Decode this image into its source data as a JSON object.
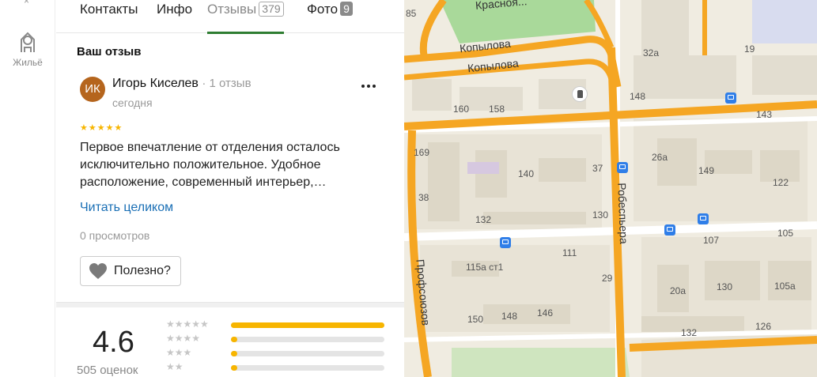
{
  "rail": {
    "top_glyph": "×",
    "housing_label": "Жильё"
  },
  "tabs": [
    {
      "label": "Контакты"
    },
    {
      "label": "Инфо"
    },
    {
      "label": "Отзывы",
      "count": "379"
    },
    {
      "label": "Фото",
      "count": "9"
    }
  ],
  "your_review": {
    "title": "Ваш отзыв",
    "avatar_initials": "ИК",
    "author": "Игорь Киселев",
    "author_reviews": "· 1 отзыв",
    "date": "сегодня",
    "stars": "★★★★★",
    "rating": 5,
    "text": "Первое впечатление от отделения осталось исключительно положительное. Удобное расположение, современный интерьер,…",
    "read_more": "Читать целиком",
    "views": "0 просмотров",
    "helpful": "Полезно?"
  },
  "summary": {
    "average": "4.6",
    "count": "505 оценок",
    "distribution": [
      {
        "stars": "★★★★★",
        "share": 1.0
      },
      {
        "stars": "★★★★",
        "share": 0.04
      },
      {
        "stars": "★★★",
        "share": 0.04
      },
      {
        "stars": "★★",
        "share": 0.04
      }
    ]
  },
  "map": {
    "streets": {
      "krasnoyarsky": "Красноя...",
      "kopylova_1": "Копылова",
      "kopylova_2": "Копылова",
      "robespera": "Робеспьера",
      "profsoyuzov": "Профсоюзов"
    },
    "buildings": [
      "85",
      "32а",
      "19",
      "148",
      "143",
      "160",
      "158",
      "169",
      "26а",
      "149",
      "140",
      "37",
      "122",
      "38",
      "132",
      "130",
      "107",
      "105",
      "111",
      "115а ст1",
      "29",
      "20а",
      "130",
      "105а",
      "150",
      "148",
      "146",
      "132",
      "126"
    ],
    "colors": {
      "land": "#f0ece1",
      "major_road": "#f5a623",
      "park": "#a9d99a",
      "building": "#e2ddd0",
      "transit": "#2f7ee8"
    }
  }
}
